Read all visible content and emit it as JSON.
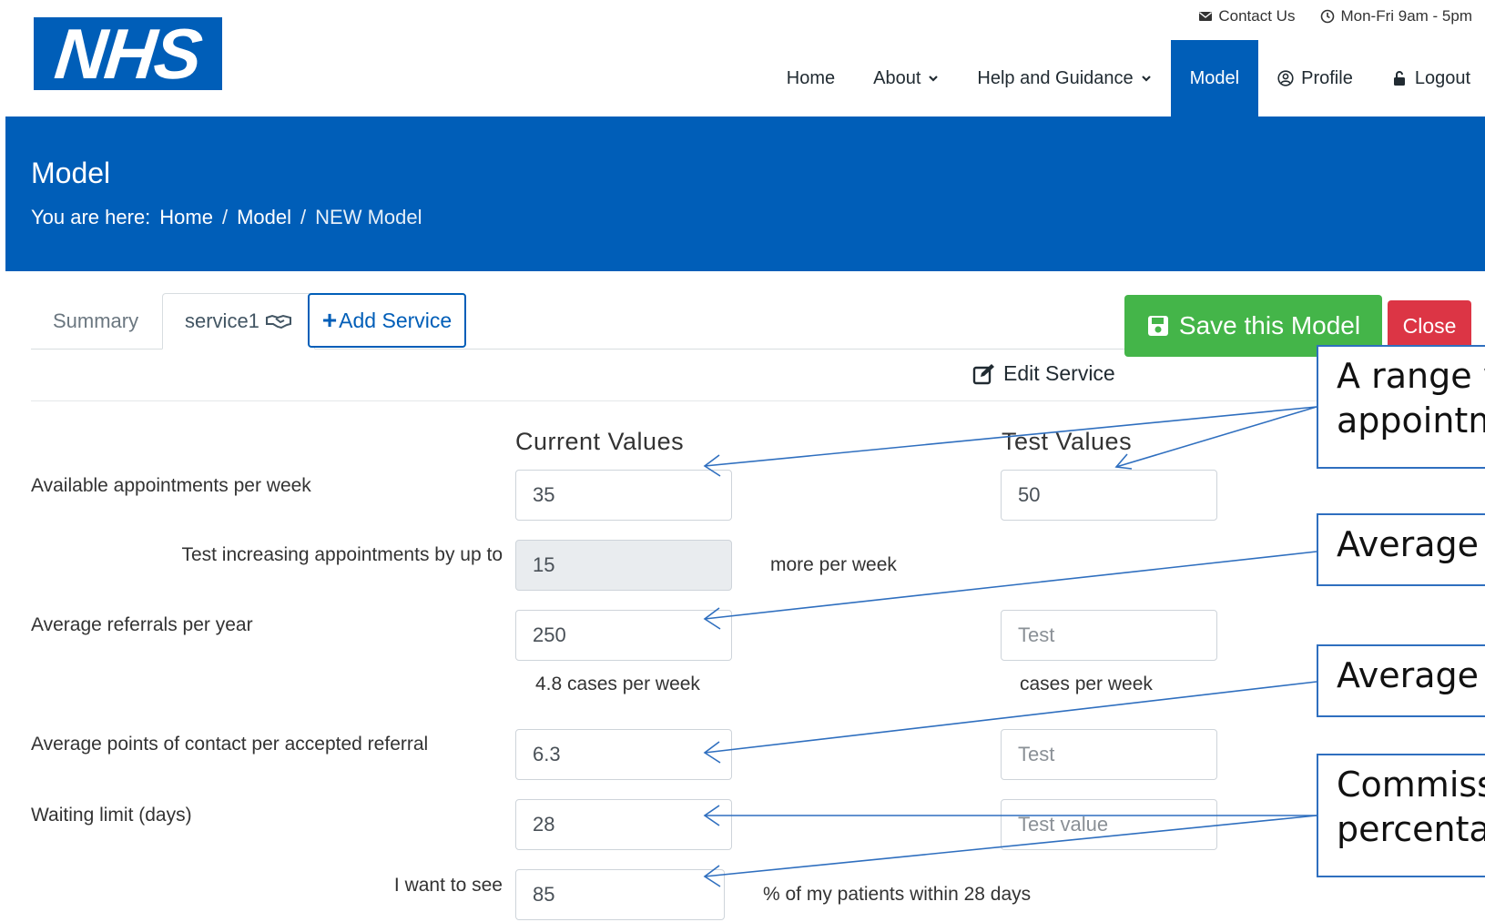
{
  "logo": {
    "text": "NHS"
  },
  "topbar": {
    "contact": "Contact Us",
    "hours": "Mon-Fri 9am - 5pm"
  },
  "nav": {
    "home": "Home",
    "about": "About",
    "help": "Help and Guidance",
    "model": "Model",
    "profile": "Profile",
    "logout": "Logout",
    "active": "Model"
  },
  "banner": {
    "title": "Model",
    "crumb_prefix": "You are here:",
    "crumbs": [
      "Home",
      "Model",
      "NEW Model"
    ],
    "sep": "/"
  },
  "tabs": {
    "summary": "Summary",
    "service1": "service1",
    "add_service": "Add Service"
  },
  "actions": {
    "save": "Save this Model",
    "close": "Close",
    "edit_service": "Edit Service"
  },
  "form": {
    "current_header": "Current Values",
    "test_header": "Test Values",
    "rows": {
      "appointments": {
        "label": "Available appointments per week",
        "current": "35",
        "test": "50"
      },
      "increase": {
        "label": "Test increasing appointments by up to",
        "value": "15",
        "suffix": "more per week"
      },
      "referrals": {
        "label": "Average referrals per year",
        "current": "250",
        "test_placeholder": "Test",
        "current_note": "4.8 cases per week",
        "test_note": "cases per week"
      },
      "contacts": {
        "label": "Average points of contact per accepted referral",
        "current": "6.3",
        "test_placeholder": "Test"
      },
      "waiting": {
        "label": "Waiting limit (days)",
        "current": "28",
        "test_placeholder": "Test value"
      },
      "target": {
        "label": "I want to see",
        "value": "85",
        "suffix": "% of my patients within 28 days"
      }
    }
  },
  "callouts": {
    "c1_line1": "A range w",
    "c1_line2": "appointm",
    "c2": "Average r",
    "c3": "Average p",
    "c4_line1": "Commissi",
    "c4_line2": "percenta"
  },
  "colors": {
    "nhs_blue": "#005eb8",
    "save_green": "#44b549",
    "close_red": "#dc3545",
    "arrow_blue": "#2f6fbf"
  }
}
